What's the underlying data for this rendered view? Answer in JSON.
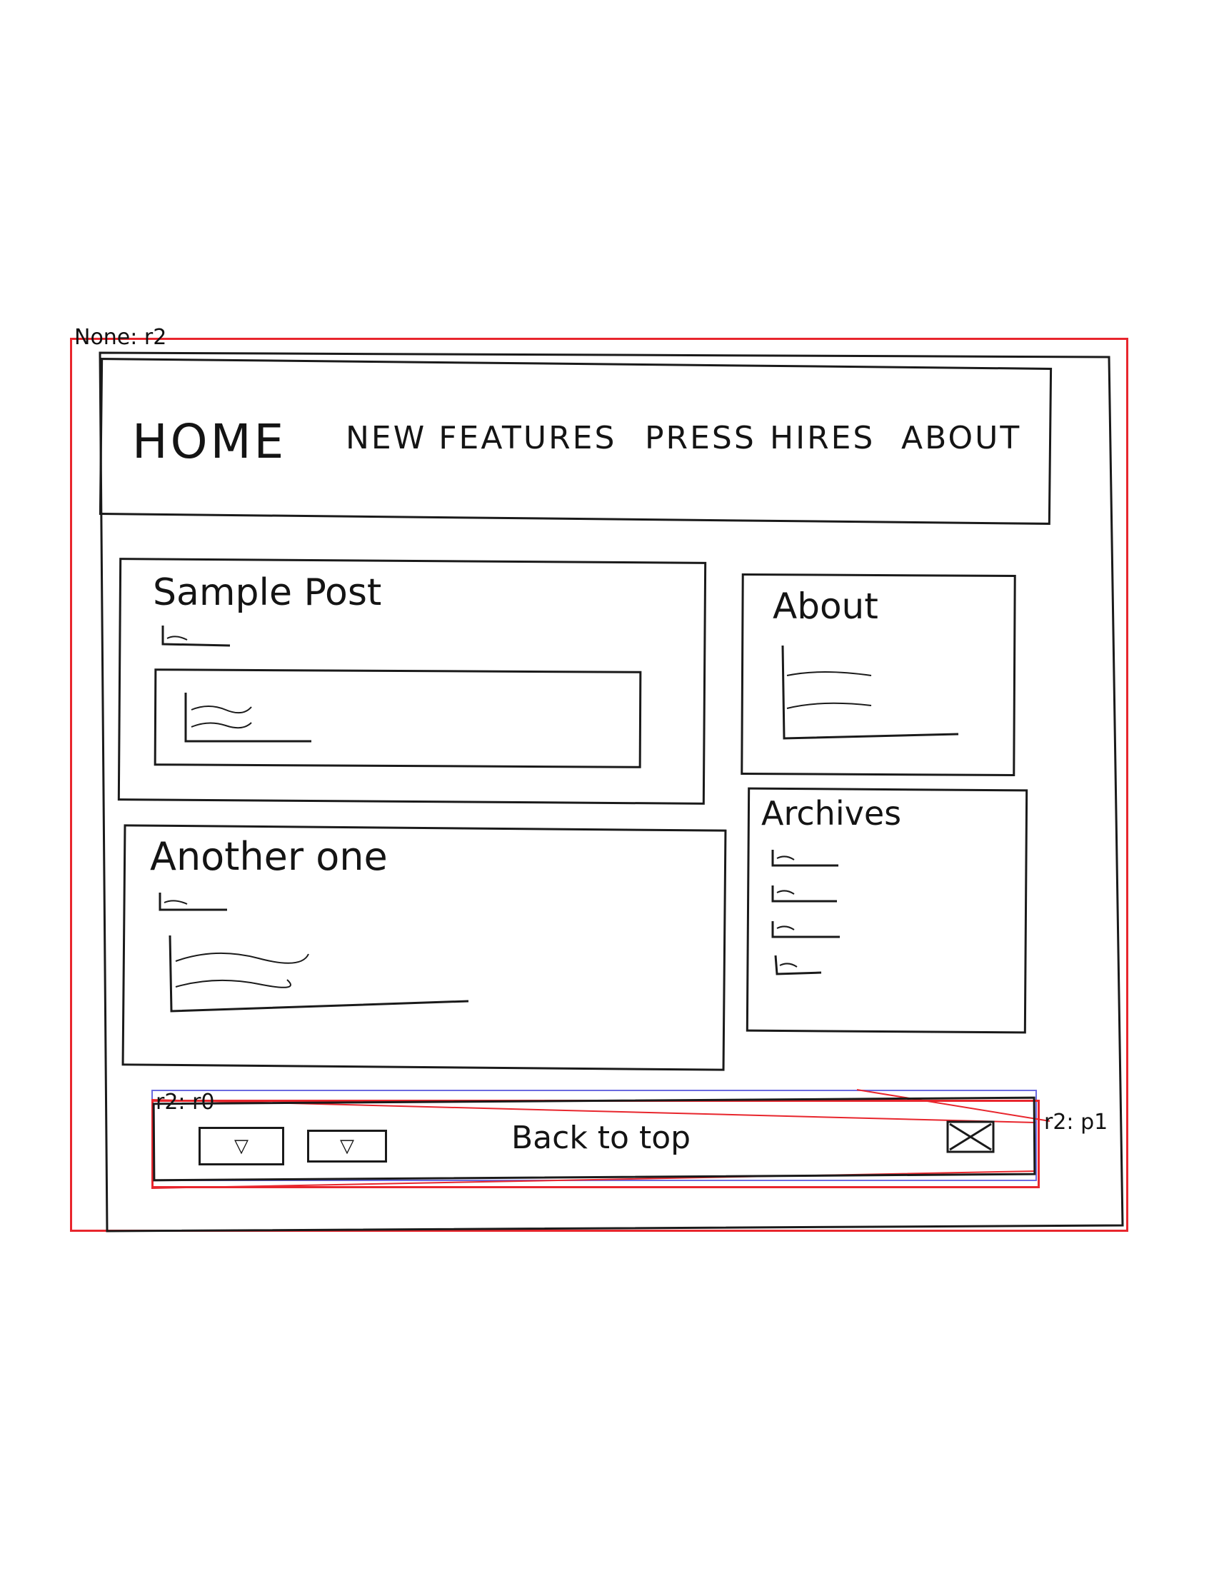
{
  "annotations": {
    "outer_label": "None: r2",
    "footer_label": "r2: r0",
    "close_label": "r2: p1"
  },
  "nav": {
    "home": "HOME",
    "items": [
      "NEW FEATURES",
      "PRESS",
      "HIRES",
      "ABOUT"
    ]
  },
  "posts": [
    {
      "title": "Sample Post"
    },
    {
      "title": "Another one"
    }
  ],
  "sidebar": {
    "about_title": "About",
    "archives_title": "Archives"
  },
  "footer": {
    "back_to_top": "Back to top",
    "dropdown_icon": "triangle-down-icon",
    "close_icon": "close-icon"
  },
  "colors": {
    "annotation": "#e8262d",
    "annotation_secondary": "#6a6ae0",
    "sketch": "#1a1a1a"
  }
}
